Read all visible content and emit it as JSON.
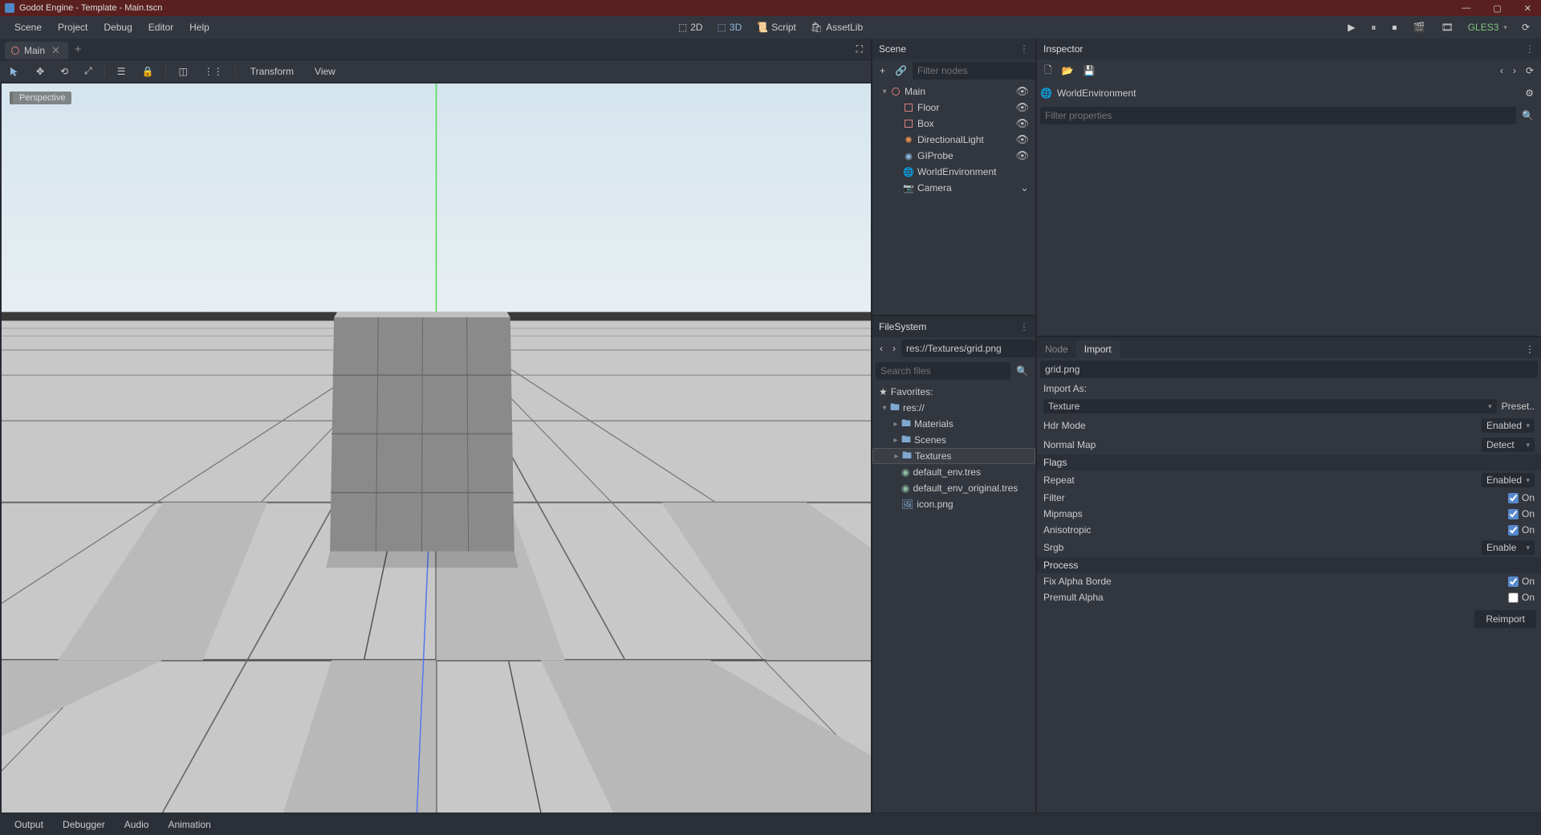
{
  "titlebar": {
    "title": "Godot Engine - Template - Main.tscn"
  },
  "menubar": {
    "items": [
      "Scene",
      "Project",
      "Debug",
      "Editor",
      "Help"
    ],
    "center": {
      "btn_2d": "2D",
      "btn_3d": "3D",
      "btn_script": "Script",
      "btn_assetlib": "AssetLib"
    },
    "renderer": "GLES3"
  },
  "scene_tab": {
    "name": "Main"
  },
  "toolbar": {
    "transform": "Transform",
    "view": "View"
  },
  "viewport": {
    "badge": "Perspective"
  },
  "scene_panel": {
    "title": "Scene",
    "filter_placeholder": "Filter nodes",
    "nodes": [
      {
        "name": "Main",
        "indent": 0,
        "arrow": "▾",
        "icon": "circle",
        "eye": true
      },
      {
        "name": "Floor",
        "indent": 1,
        "arrow": "",
        "icon": "cube",
        "eye": true
      },
      {
        "name": "Box",
        "indent": 1,
        "arrow": "",
        "icon": "cube",
        "eye": true
      },
      {
        "name": "DirectionalLight",
        "indent": 1,
        "arrow": "",
        "icon": "light",
        "eye": true
      },
      {
        "name": "GIProbe",
        "indent": 1,
        "arrow": "",
        "icon": "gi",
        "eye": true
      },
      {
        "name": "WorldEnvironment",
        "indent": 1,
        "arrow": "",
        "icon": "world",
        "eye": false
      },
      {
        "name": "Camera",
        "indent": 1,
        "arrow": "",
        "icon": "camera",
        "eye": false
      }
    ]
  },
  "filesystem": {
    "title": "FileSystem",
    "path": "res://Textures/grid.png",
    "search_placeholder": "Search files",
    "favorites": "Favorites:",
    "tree": [
      {
        "name": "res://",
        "indent": 0,
        "arrow": "▾",
        "type": "folder"
      },
      {
        "name": "Materials",
        "indent": 1,
        "arrow": "▸",
        "type": "folder"
      },
      {
        "name": "Scenes",
        "indent": 1,
        "arrow": "▸",
        "type": "folder"
      },
      {
        "name": "Textures",
        "indent": 1,
        "arrow": "▸",
        "type": "folder",
        "selected": true
      },
      {
        "name": "default_env.tres",
        "indent": 1,
        "arrow": "",
        "type": "res"
      },
      {
        "name": "default_env_original.tres",
        "indent": 1,
        "arrow": "",
        "type": "res"
      },
      {
        "name": "icon.png",
        "indent": 1,
        "arrow": "",
        "type": "img"
      }
    ]
  },
  "inspector": {
    "title": "Inspector",
    "object": "WorldEnvironment",
    "filter_placeholder": "Filter properties"
  },
  "import": {
    "tab_node": "Node",
    "tab_import": "Import",
    "file": "grid.png",
    "import_as_label": "Import As:",
    "import_as_value": "Texture",
    "preset": "Preset..",
    "props": [
      {
        "label": "Hdr Mode",
        "value": "Enabled",
        "type": "dropdown"
      },
      {
        "label": "Normal Map",
        "value": "Detect",
        "type": "dropdown"
      }
    ],
    "flags_label": "Flags",
    "flags": [
      {
        "label": "Repeat",
        "value": "Enabled",
        "type": "dropdown"
      },
      {
        "label": "Filter",
        "value": "On",
        "type": "check",
        "checked": true
      },
      {
        "label": "Mipmaps",
        "value": "On",
        "type": "check",
        "checked": true
      },
      {
        "label": "Anisotropic",
        "value": "On",
        "type": "check",
        "checked": true
      },
      {
        "label": "Srgb",
        "value": "Enable",
        "type": "dropdown"
      }
    ],
    "process_label": "Process",
    "process": [
      {
        "label": "Fix Alpha Borde",
        "value": "On",
        "type": "check",
        "checked": true
      },
      {
        "label": "Premult Alpha",
        "value": "On",
        "type": "check",
        "checked": false
      }
    ],
    "reimport": "Reimport"
  },
  "bottom": {
    "tabs": [
      "Output",
      "Debugger",
      "Audio",
      "Animation"
    ]
  }
}
